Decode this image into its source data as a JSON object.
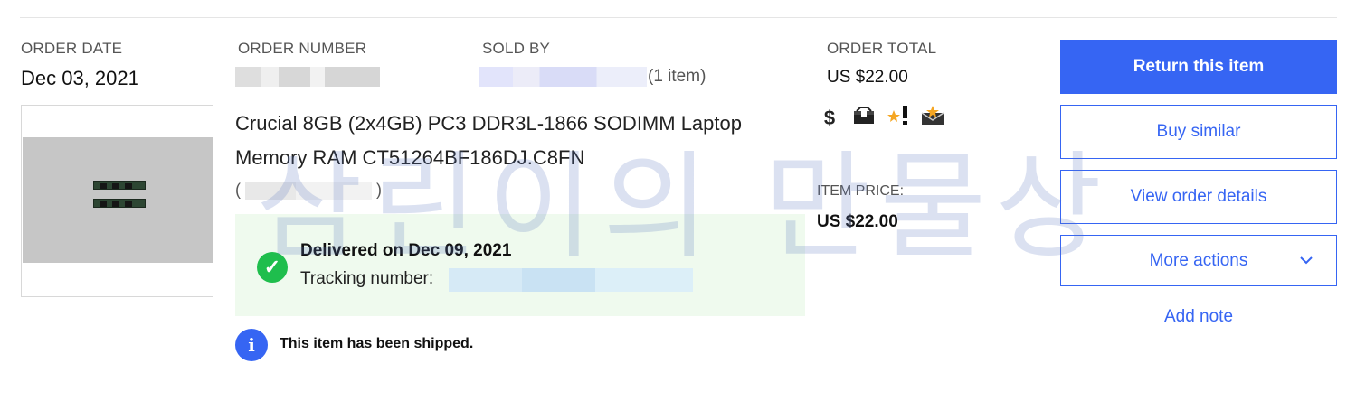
{
  "order": {
    "date_label": "ORDER DATE",
    "date_value": "Dec 03, 2021",
    "number_label": "ORDER NUMBER",
    "sold_by_label": "SOLD BY",
    "item_count": "(1 item)",
    "total_label": "ORDER TOTAL",
    "total_value": "US $22.00"
  },
  "icons": [
    "dollar-icon",
    "package-icon",
    "star-seller-icon",
    "feedback-mail-icon"
  ],
  "item": {
    "title": "Crucial 8GB (2x4GB) PC3 DDR3L-1866 SODIMM Laptop Memory RAM CT51264BF186DJ.C8FN",
    "variant_open": "(",
    "variant_close": ")",
    "price_label": "ITEM PRICE:",
    "price_value": "US $22.00"
  },
  "delivery": {
    "status": "Delivered on Dec 09, 2021",
    "tracking_label": "Tracking number:",
    "shipped_notice": "This item has been shipped."
  },
  "actions": {
    "return": "Return this item",
    "buy_similar": "Buy similar",
    "view_details": "View order details",
    "more_actions": "More actions",
    "add_note": "Add note"
  },
  "watermark": "삼린이의 만물상",
  "colors": {
    "accent": "#3665f3",
    "success": "#1fbe4d",
    "delivered_bg": "#effaee"
  }
}
